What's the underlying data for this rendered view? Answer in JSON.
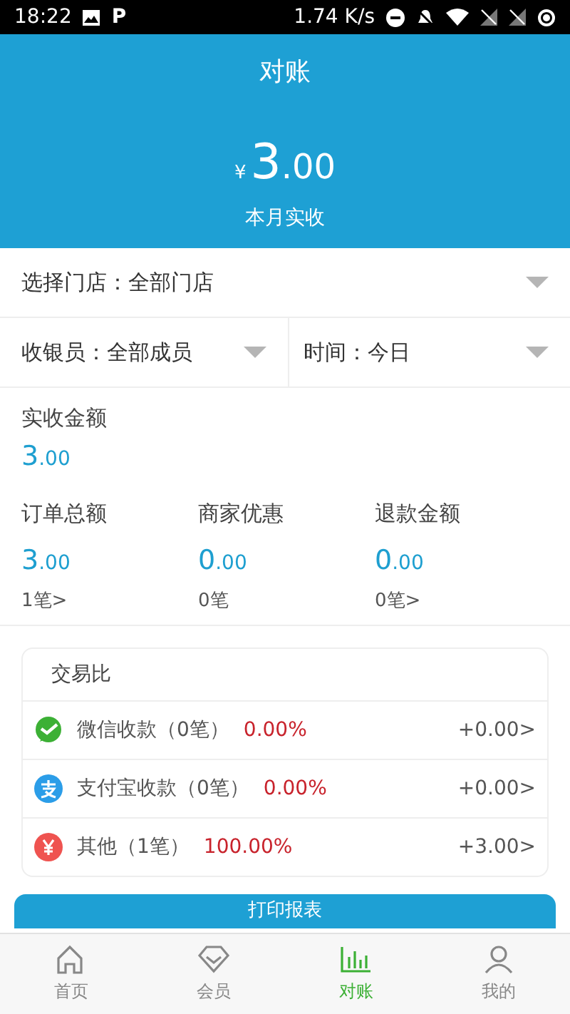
{
  "status_bar": {
    "time": "18:22",
    "app_badge": "P",
    "speed": "1.74 K/s"
  },
  "header": {
    "title": "对账",
    "currency": "¥",
    "amount_int": "3",
    "amount_dec": ".00",
    "caption": "本月实收"
  },
  "filters": [
    {
      "text": "选择门店：全部门店"
    },
    {
      "text": "收银员：全部成员"
    },
    {
      "text": "时间：今日"
    }
  ],
  "received": {
    "label": "实收金额",
    "int": "3",
    "dec": ".00"
  },
  "stats": [
    {
      "label": "订单总额",
      "int": "3",
      "dec": ".00",
      "count": "1笔>"
    },
    {
      "label": "商家优惠",
      "int": "0",
      "dec": ".00",
      "count": "0笔"
    },
    {
      "label": "退款金额",
      "int": "0",
      "dec": ".00",
      "count": "0笔>"
    }
  ],
  "trade_card": {
    "title": "交易比",
    "rows": [
      {
        "kind": "wechat",
        "name": "微信收款（0笔）",
        "percent": "0.00%",
        "amount": "+0.00>"
      },
      {
        "kind": "alipay",
        "name": "支付宝收款（0笔）",
        "percent": "0.00%",
        "amount": "+0.00>"
      },
      {
        "kind": "other",
        "name": "其他（1笔）",
        "percent": "100.00%",
        "amount": "+3.00>"
      }
    ]
  },
  "print_button": "打印报表",
  "tabs": [
    {
      "kind": "home",
      "label": "首页",
      "selected": false
    },
    {
      "kind": "member",
      "label": "会员",
      "selected": false
    },
    {
      "kind": "chart",
      "label": "对账",
      "selected": true
    },
    {
      "kind": "profile",
      "label": "我的",
      "selected": false
    }
  ]
}
